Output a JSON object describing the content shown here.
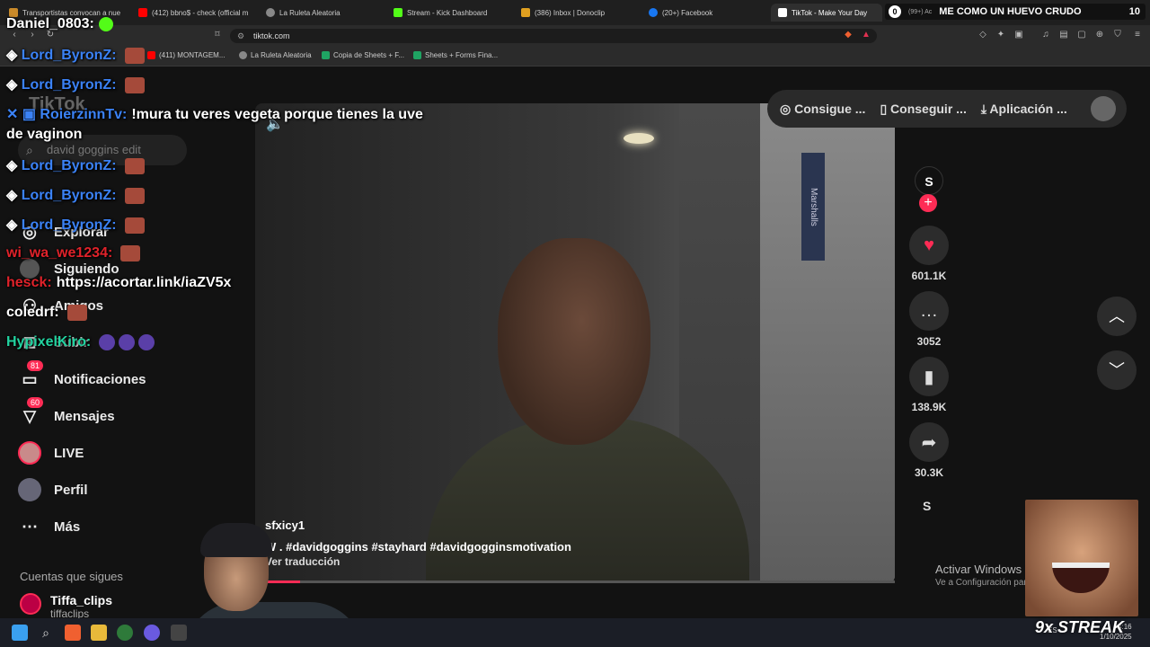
{
  "browser": {
    "tabs": [
      {
        "label": "Transportistas convocan a nue",
        "color": "#c98a2a"
      },
      {
        "label": "(412) bbno$ - check (official m",
        "color": "#ff0000"
      },
      {
        "label": "La Ruleta Aleatoria",
        "color": "#888888"
      },
      {
        "label": "Stream - Kick Dashboard",
        "color": "#53fc18"
      },
      {
        "label": "(386) Inbox | Donoclip",
        "color": "#e0a020"
      },
      {
        "label": "(20+) Facebook",
        "color": "#1877f2"
      },
      {
        "label": "TikTok - Make Your Day",
        "color": "#ffffff"
      }
    ],
    "url": "tiktok.com",
    "bookmarks": [
      {
        "label": "(411) MONTAGEM...",
        "color": "#ff0000"
      },
      {
        "label": "La Ruleta Aleatoria",
        "color": "#888888"
      },
      {
        "label": "Copia de Sheets + F...",
        "color": "#1fa463"
      },
      {
        "label": "Sheets + Forms Fina...",
        "color": "#1fa463"
      }
    ]
  },
  "stream_header": {
    "count_left": "0",
    "text": "ME COMO UN HUEVO CRUDO",
    "count_right": "10",
    "sub": "(99+) Ac"
  },
  "tiktok": {
    "logo": "TikTok",
    "search_placeholder": "david goggins edit",
    "nav": [
      {
        "label": "Explorar",
        "icon": "compass-icon"
      },
      {
        "label": "Siguiendo",
        "icon": "following-icon"
      },
      {
        "label": "Amigos",
        "icon": "friends-icon"
      },
      {
        "label": "Subir",
        "icon": "upload-icon"
      },
      {
        "label": "Notificaciones",
        "icon": "inbox-icon",
        "badge": "81"
      },
      {
        "label": "Mensajes",
        "icon": "send-icon",
        "badge": "60"
      },
      {
        "label": "LIVE",
        "icon": "live-icon"
      },
      {
        "label": "Perfil",
        "icon": "profile-icon"
      },
      {
        "label": "Más",
        "icon": "more-icon"
      }
    ],
    "following_title": "Cuentas que sigues",
    "following": [
      {
        "name": "Tiffa_clips",
        "handle": "tiffaclips"
      }
    ],
    "top_pill": {
      "coins": "Consigue ...",
      "app": "Conseguir ...",
      "download": "Aplicación ..."
    },
    "video": {
      "author": "sfxicy1",
      "description": "W . #davidgoggins #stayhard #davidgogginsmotivation",
      "translate": "Ver traducción",
      "sign_text": "Marshalls",
      "progress": 0.07
    },
    "actions": {
      "likes": "601.1K",
      "comments": "3052",
      "saves": "138.9K",
      "shares": "30.3K"
    },
    "profile_letter": "S"
  },
  "windows_activation": {
    "line1": "Activar Windows",
    "line2": "Ve a Configuración par"
  },
  "chat": [
    {
      "user": "Daniel_0803:",
      "color": "#ffffff",
      "text": ""
    },
    {
      "user": "Lord_ByronZ:",
      "color": "#3b82f6",
      "text": ""
    },
    {
      "user": "Lord_ByronZ:",
      "color": "#3b82f6",
      "text": ""
    },
    {
      "user": "RoierzinnTv:",
      "color": "#3b82f6",
      "text": "!mura tu veres vegeta porque tienes la uve"
    },
    {
      "user": "",
      "color": "#ffffff",
      "text": "de vaginon"
    },
    {
      "user": "Lord_ByronZ:",
      "color": "#3b82f6",
      "text": ""
    },
    {
      "user": "Lord_ByronZ:",
      "color": "#3b82f6",
      "text": ""
    },
    {
      "user": "Lord_ByronZ:",
      "color": "#3b82f6",
      "text": ""
    },
    {
      "user": "wi_wa_we1234:",
      "color": "#e0222a",
      "text": ""
    },
    {
      "user": "hesck:",
      "color": "#e0222a",
      "text": "https://acortar.link/iaZV5x"
    },
    {
      "user": "coledrf:",
      "color": "#ffffff",
      "text": ""
    },
    {
      "user": "HypixelKiro:",
      "color": "#22d3a0",
      "text": ""
    }
  ],
  "streak": "9x STREAK",
  "taskbar": {
    "lang": "ES",
    "time": "4:16",
    "date": "1/10/2025"
  }
}
